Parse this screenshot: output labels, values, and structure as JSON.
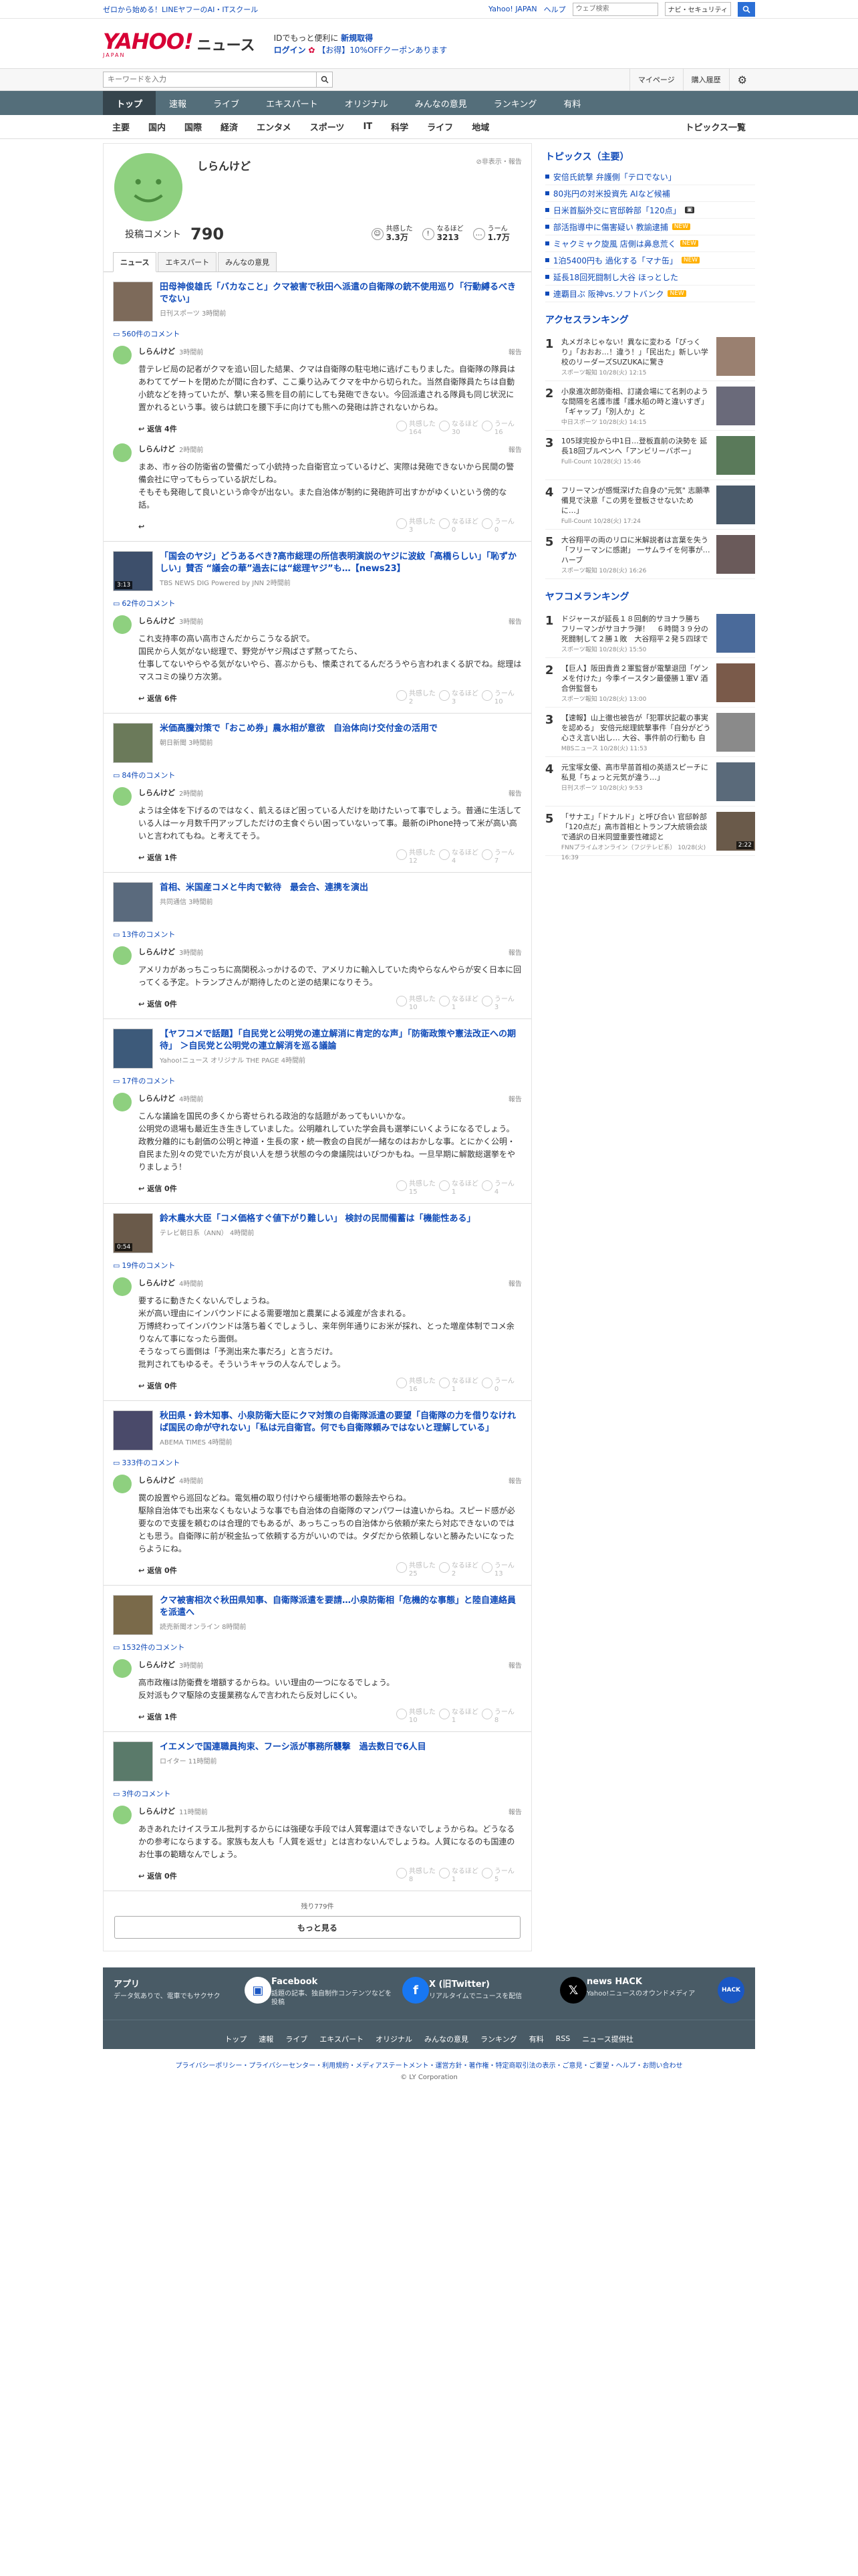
{
  "topbar": {
    "promo": "ゼロから始める！LINEヤフーのAI・ITスクール",
    "yahoo": "Yahoo! JAPAN",
    "help": "ヘルプ",
    "search_placeholder": "ウェブ検索",
    "search_mode": "ナビ・セキュリティ"
  },
  "brand": {
    "logo": "YAHOO!",
    "logo_sub": "JAPAN",
    "name": "ニュース",
    "login_msg": "IDでもっと便利に",
    "register": "新規取得",
    "login": "ログイン",
    "coupon": "【お得】10%OFFクーポンあります"
  },
  "search": {
    "placeholder": "キーワードを入力",
    "mypage": "マイページ",
    "history": "購入履歴"
  },
  "gnav": [
    "トップ",
    "速報",
    "ライブ",
    "エキスパート",
    "オリジナル",
    "みんなの意見",
    "ランキング",
    "有料"
  ],
  "cnav": [
    "主要",
    "国内",
    "国際",
    "経済",
    "エンタメ",
    "スポーツ",
    "IT",
    "科学",
    "ライフ",
    "地域"
  ],
  "cnav_all": "トピックス一覧",
  "profile": {
    "name": "しらんけど",
    "report": "非表示・報告",
    "posts_label": "投稿コメント",
    "posts": "790",
    "agree_label": "共感した",
    "agree": "3.3万",
    "naru_label": "なるほど",
    "naru": "3213",
    "uun_label": "うーん",
    "uun": "1.7万"
  },
  "tabs": [
    "ニュース",
    "エキスパート",
    "みんなの意見"
  ],
  "articles": [
    {
      "title": "田母神俊雄氏「バカなこと」クマ被害で秋田へ派遣の自衛隊の銃不使用巡り「行動縛るべきでない」",
      "source": "日刊スポーツ 3時間前",
      "count": "560件のコメント",
      "video": "",
      "comments": [
        {
          "time": "3時間前",
          "text": "昔テレビ局の記者がクマを追い回した結果、クマは自衛隊の駐屯地に逃げこもりました。自衛隊の隊員はあわててゲートを閉めたが間に合わず、ここ乗り込みてクマを中から切られた。当然自衛隊員たちは自動小銃などを持っていたが、撃い来る熊を目の前にしても発砲できない。今回派遣される隊員も同じ状況に置かれるという事。彼らは銃口を腰下手に向けても熊への発砲は許されないからね。",
          "replies": "返信 4件",
          "a": "164",
          "b": "30",
          "c": "16"
        },
        {
          "time": "2時間前",
          "text": "まあ、市ヶ谷の防衛省の警備だって小銃持った自衛官立っているけど、実際は発砲できないから民間の警備会社に守ってもらっている訳だしね。\nそもそも発砲して良いという命令が出ない。また自治体が制約に発砲許可出すかがゆくいという傍的な話。",
          "replies": "",
          "a": "3",
          "b": "0",
          "c": "0"
        }
      ]
    },
    {
      "title": "「国会のヤジ」どうあるべき?高市総理の所信表明演説のヤジに波紋「高橋らしい」「恥ずかしい」賛否 “議会の華”過去には“総理ヤジ”も…【news23】",
      "source": "TBS NEWS DIG Powered by JNN 2時間前",
      "count": "62件のコメント",
      "video": "3:13",
      "comments": [
        {
          "time": "3時間前",
          "text": "これ支持率の高い高市さんだからこうなる訳で。\n国民から人気がない総理で、野党がヤジ飛ばさず黙ってたら、\n仕事してないやらやる気がないやら、喜ぶからも、懐柔されてるんだろうやら言われまくる訳でね。総理はマスコミの操り方次第。",
          "replies": "返信 6件",
          "a": "2",
          "b": "3",
          "c": "10"
        }
      ]
    },
    {
      "title": "米価高騰対策で「おこめ券」農水相が意欲　自治体向け交付金の活用で",
      "source": "朝日新聞 3時間前",
      "count": "84件のコメント",
      "video": "",
      "comments": [
        {
          "time": "2時間前",
          "text": "ようは全体を下げるのではなく、飢えるほど困っている人だけを助けたいって事でしょう。普通に生活している人は一ヶ月数千円アップしただけの主食ぐらい困っていないって事。最新のiPhone持って米が高い高いと言われてもね。と考えてそう。",
          "replies": "返信 1件",
          "a": "12",
          "b": "4",
          "c": "7"
        }
      ]
    },
    {
      "title": "首相、米国産コメと牛肉で歓待　最会合、連携を演出",
      "source": "共同通信 3時間前",
      "count": "13件のコメント",
      "video": "",
      "comments": [
        {
          "time": "3時間前",
          "text": "アメリカがあっちこっちに高関税ふっかけるので、アメリカに輸入していた肉やらなんやらが安く日本に回ってくる予定。トランプさんが期待したのと逆の結果になりそう。",
          "replies": "返信 0件",
          "a": "10",
          "b": "1",
          "c": "3"
        }
      ]
    },
    {
      "title": "【ヤフコメで話題】「自民党と公明党の連立解消に肯定的な声」「防衛政策や憲法改正への期待」 ＞自民党と公明党の連立解消を巡る議論",
      "source": "Yahoo!ニュース オリジナル THE PAGE 4時間前",
      "count": "17件のコメント",
      "video": "",
      "comments": [
        {
          "time": "4時間前",
          "text": "こんな議論を国民の多くから寄せられる政治的な話題があってもいいかな。\n公明党の退場も最近生き生きしていました。公明離れしていた学会員も選挙にいくようになるでしょう。政教分離的にも創価の公明と神道・生長の家・統一教会の自民が一緒なのはおかしな事。とにかく公明・自民また別々の党でいた方が良い人を想う状態の今の衆議院はいびつかもね。一旦早期に解散総選挙をやりましょう！",
          "replies": "返信 0件",
          "a": "15",
          "b": "1",
          "c": "4"
        }
      ]
    },
    {
      "title": "鈴木農水大臣「コメ価格すぐ値下がり難しい」 検討の民間備蓄は「機能性ある」",
      "source": "テレビ朝日系（ANN） 4時間前",
      "count": "19件のコメント",
      "video": "0:54",
      "comments": [
        {
          "time": "4時間前",
          "text": "要するに動きたくないんでしょうね。\n米が高い理由にインバウンドによる需要増加と農業による減産が含まれる。\n万博終わってインバウンドは落ち着くでしょうし、来年例年通りにお米が採れ、とった増産体制でコメ余りなんて事になったら面倒。\nそうなってら面倒は「予測出来た事だろ」と言うだけ。\n批判されてもゆるそ。そういうキャラの人なんでしょう。",
          "replies": "返信 0件",
          "a": "16",
          "b": "1",
          "c": "0"
        }
      ]
    },
    {
      "title": "秋田県・鈴木知事、小泉防衛大臣にクマ対策の自衛隊派遣の要望「自衛隊の力を借りなければ国民の命が守れない」「私は元自衛官。何でも自衛隊頼みではないと理解している」",
      "source": "ABEMA TIMES 4時間前",
      "count": "333件のコメント",
      "video": "",
      "comments": [
        {
          "time": "4時間前",
          "text": "罠の設置やら巡回などね。電気柵の取り付けやら緩衝地帯の藪除去やらね。\n駆除自治体でも出来なくもないような事でも自治体の自衛隊のマンパワーは違いからね。スピード感が必要なので支援を頼むのは合理的でもあるが、あっちこっちの自治体から依頼が来たら対応できないのではとも思う。自衛隊に前が税金払って依頼する方がいいのでは。タダだから依頼しないと勝みたいになったらようにね。",
          "replies": "返信 0件",
          "a": "25",
          "b": "2",
          "c": "13"
        }
      ]
    },
    {
      "title": "クマ被害相次ぐ秋田県知事、自衛隊派遣を要請…小泉防衛相「危機的な事態」と陸自連絡員を派遣へ",
      "source": "読売新聞オンライン 8時間前",
      "count": "1532件のコメント",
      "video": "",
      "comments": [
        {
          "time": "3時間前",
          "text": "高市政権は防衛費を増額するからね。いい理由の一つになるでしょう。\n反対派もクマ駆除の支援業務なんで言われたら反対しにくい。",
          "replies": "返信 1件",
          "a": "10",
          "b": "1",
          "c": "8"
        }
      ]
    },
    {
      "title": "イエメンで国連職員拘束、フーシ派が事務所襲撃　過去数日で6人目",
      "source": "ロイター 11時間前",
      "count": "3件のコメント",
      "video": "",
      "comments": [
        {
          "time": "11時間前",
          "text": "あきあれたけイスラエル批判するからには強硬な手段では人質奪還はできないでしょうからね。どうなるかの参考にならまする。家族も友人も「人質を返せ」とは言わないんでしょうね。人質になるのも国連のお仕事の範疇なんでしょう。",
          "replies": "返信 0件",
          "a": "8",
          "b": "1",
          "c": "5"
        }
      ]
    }
  ],
  "more": {
    "rest": "残り779件",
    "button": "もっと見る"
  },
  "side": {
    "topics_title": "トピックス（主要）",
    "topics": [
      {
        "t": "安倍氏銃撃 弁護側「テロでない」",
        "tag": ""
      },
      {
        "t": "80兆円の対米投資先 AIなど候補",
        "tag": ""
      },
      {
        "t": "日米首脳外交に官邸幹部「120点」",
        "tag": "img"
      },
      {
        "t": "部活指導中に傷害疑い 教諭逮捕",
        "tag": "new"
      },
      {
        "t": "ミャクミャク旋風 店側は鼻息荒く",
        "tag": "new"
      },
      {
        "t": "1泊5400円も 過化する「マナ缶」",
        "tag": "new"
      },
      {
        "t": "延長18回死闘制し大谷 ほっとした",
        "tag": ""
      },
      {
        "t": "連覇目ぶ 阪神vs.ソフトバンク",
        "tag": "new"
      }
    ],
    "access_title": "アクセスランキング",
    "access": [
      {
        "t": "丸メガネじゃない！異なに変わる「ぴっくり」「おおお…！違う！」「民出た」新しい学校のリーダーズSUZUKAに驚き",
        "m": "スポーツ報知 10/28(火) 12:15",
        "v": ""
      },
      {
        "t": "小泉進次郎防衛相、訂議会場にて名刺のような間隔を名護市護「護水船の時と違いすぎ」「ギャップ」「別人か」と",
        "m": "中日スポーツ 10/28(火) 14:15",
        "v": ""
      },
      {
        "t": "105球完投から中1日…登板直前の決勢を 延長18回ブルペンへ「アンビリーバボー」",
        "m": "Full-Count 10/28(火) 15:46",
        "v": ""
      },
      {
        "t": "フリーマンが感慨深げた自身の\"元気\" 志願準備見で決意「この男を登板させないために…」",
        "m": "Full-Count 10/28(火) 17:24",
        "v": ""
      },
      {
        "t": "大谷翔平の両のリロに米解説者は言葉を失う「フリーマンに感謝」 一サムライを何事が…ハーブ",
        "m": "スポーツ報知 10/28(火) 16:26",
        "v": ""
      }
    ],
    "yahoo_title": "ヤフコメランキング",
    "yahoo": [
      {
        "t": "ドジャースが延長１８回劇的サヨナラ勝ち　フリーマンがサヨナラ弾！　６時間３９分の死闘制して２勝１敗　大谷翔平２発５四球で９度出塁",
        "m": "スポーツ報知 10/28(火) 15:50",
        "v": ""
      },
      {
        "t": "【巨人】阪田貴貴２軍監督が電撃退団「ゲンメを付けた」今季イースタン最優勝１軍V 酒合併監督も",
        "m": "スポーツ報知 10/28(火) 13:00",
        "v": ""
      },
      {
        "t": "【速報】山上徹也被告が「犯罪状記載の事実を認める」 安倍元総理銃撃事件「自分がどう心さえ言い出し… 大谷、事件前の行動も 自作のパイプ銃…事件の真相に迫る方針",
        "m": "MBSニュース 10/28(火) 11:53",
        "v": ""
      },
      {
        "t": "元宝塚女優、高市早苗首相の英語スピーチに私見「ちょっと元気が違う…」",
        "m": "日刊スポーツ 10/28(火) 9:53",
        "v": ""
      },
      {
        "t": "「サナエ」「ドナルド」と呼び合い 官邸幹部「120点だ」高市首相とトランプ大統領会談で通訳の日米同盟重要性確認と",
        "m": "FNNプライムオンライン（フジテレビ系） 10/28(火) 16:39",
        "v": "2:22"
      }
    ]
  },
  "footer": {
    "cols": [
      {
        "h": "アプリ",
        "d": "データ気ありで、電車でもサクサク",
        "icon": "app-icon"
      },
      {
        "h": "Facebook",
        "d": "話題の記事、独自制作コンテンツなどを投稿",
        "icon": "facebook-icon"
      },
      {
        "h": "X (旧Twitter)",
        "d": "リアルタイムでニュースを配信",
        "icon": "x-icon"
      },
      {
        "h": "news HACK",
        "d": "Yahoo!ニュースのオウンドメディア",
        "icon": "newshack-icon"
      }
    ],
    "links": [
      "トップ",
      "速報",
      "ライブ",
      "エキスパート",
      "オリジナル",
      "みんなの意見",
      "ランキング",
      "有料",
      "RSS",
      "ニュース提供社"
    ],
    "legal": "プライバシーポリシー・プライバシーセンター・利用規約・メディアステートメント・運営方針・著作権・特定商取引法の表示・ご意見・ご要望・ヘルプ・お問い合わせ",
    "copy": "© LY Corporation"
  },
  "colors": {
    "accent": "#0f4ab8",
    "nav": "#546e7a",
    "avatar": "#8ed07f",
    "brand_red": "#d70035"
  }
}
